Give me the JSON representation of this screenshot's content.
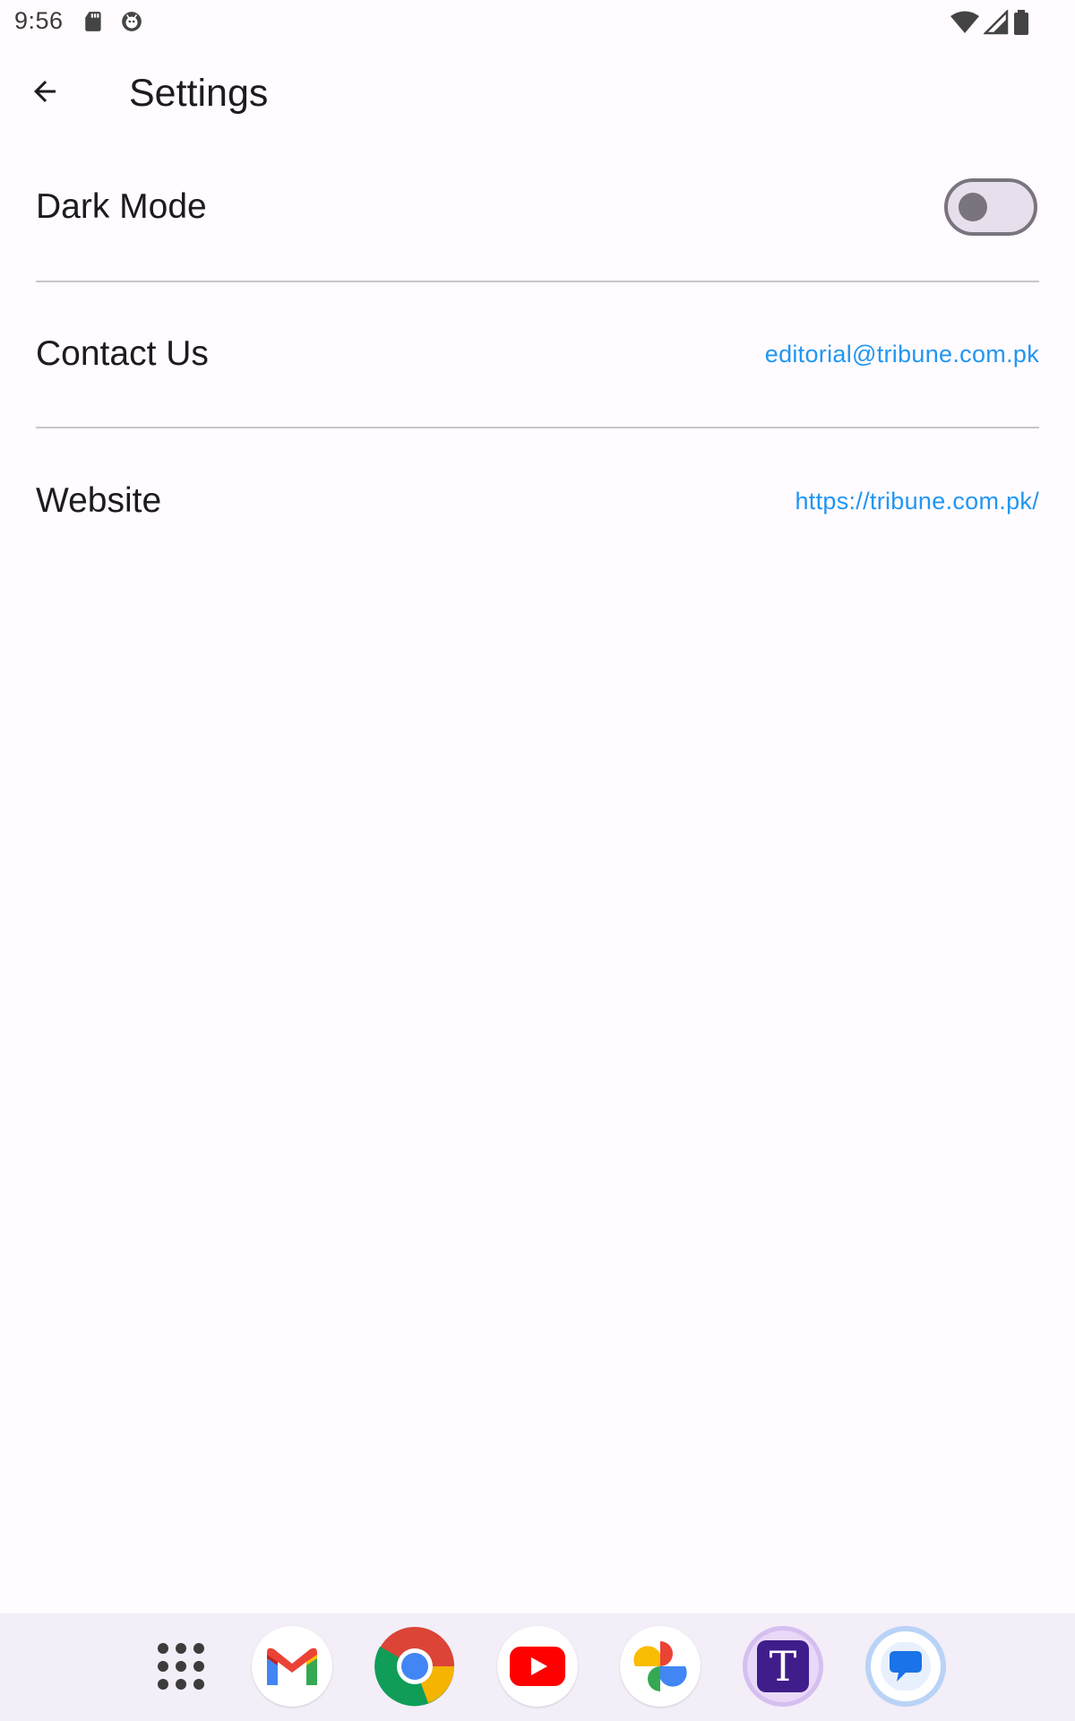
{
  "status_bar": {
    "time": "9:56",
    "left_icons": [
      "sd-card-icon",
      "android-debug-icon"
    ],
    "right_icons": [
      "wifi-icon",
      "cellular-signal-icon",
      "battery-icon"
    ]
  },
  "app_bar": {
    "back_icon": "arrow-back-icon",
    "title": "Settings"
  },
  "settings": {
    "dark_mode": {
      "label": "Dark Mode",
      "enabled": false
    },
    "contact": {
      "label": "Contact Us",
      "value": "editorial@tribune.com.pk"
    },
    "website": {
      "label": "Website",
      "value": "https://tribune.com.pk/"
    }
  },
  "dock": {
    "apps": [
      "app-drawer-icon",
      "gmail-icon",
      "chrome-icon",
      "youtube-icon",
      "google-photos-icon",
      "tribune-app-icon",
      "messages-icon"
    ],
    "tribune_letter": "T"
  },
  "colors": {
    "background": "#fffbfe",
    "link": "#2196f3",
    "switch_track": "#e7e0ec",
    "switch_outline": "#79747e",
    "dock_background": "#f3eef8"
  }
}
